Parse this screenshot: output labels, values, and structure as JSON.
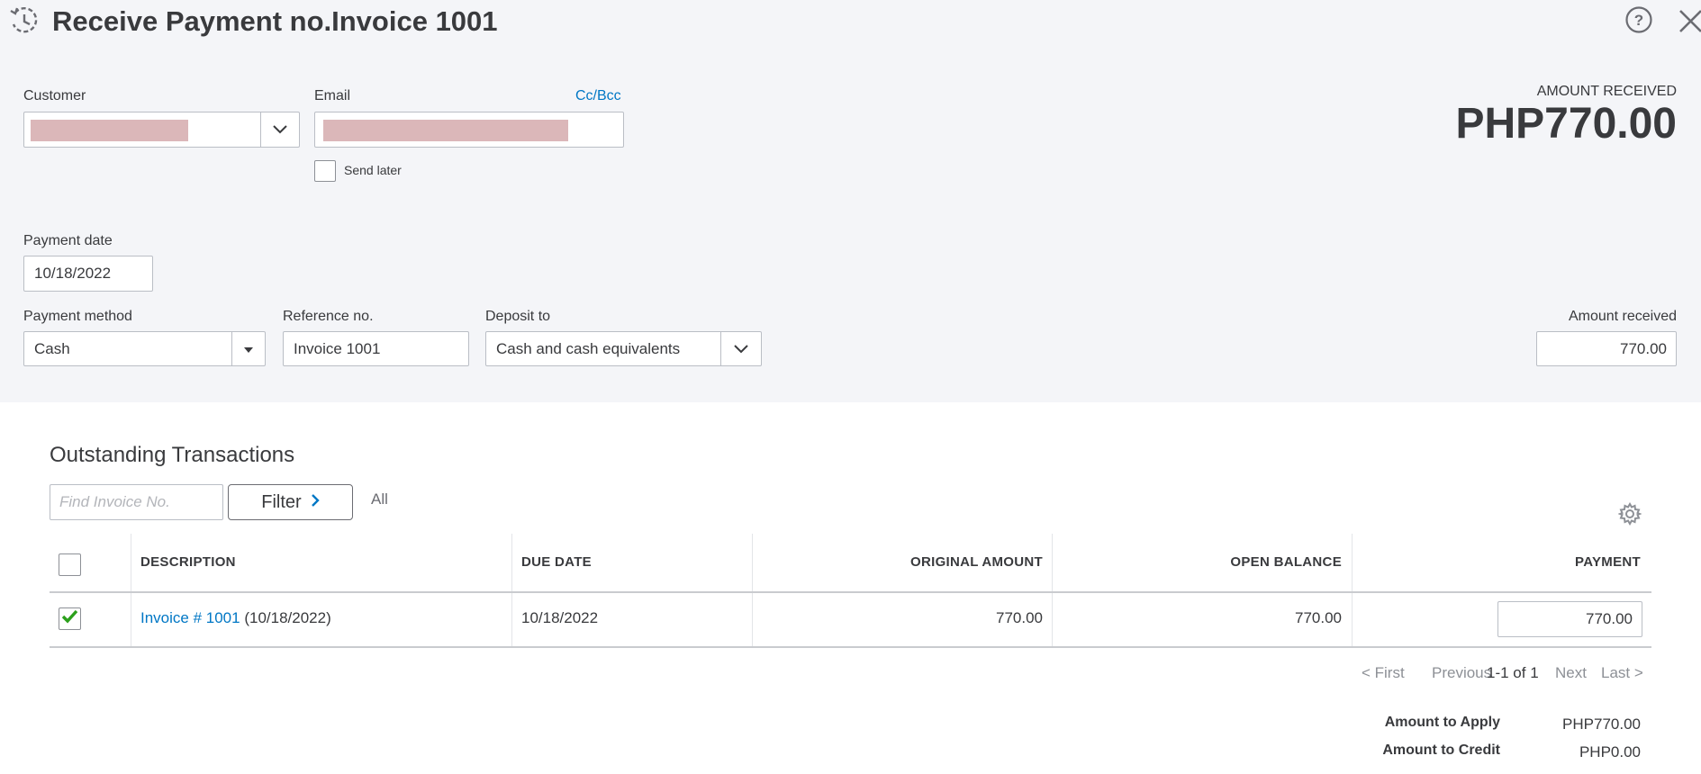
{
  "header": {
    "title": "Receive Payment no.Invoice 1001"
  },
  "customer": {
    "label": "Customer"
  },
  "email": {
    "label": "Email",
    "cc_bcc": "Cc/Bcc",
    "send_later": "Send later"
  },
  "amount_summary": {
    "label": "AMOUNT RECEIVED",
    "value": "PHP770.00"
  },
  "payment_date": {
    "label": "Payment date",
    "value": "10/18/2022"
  },
  "payment_method": {
    "label": "Payment method",
    "value": "Cash"
  },
  "reference": {
    "label": "Reference no.",
    "value": "Invoice 1001"
  },
  "deposit_to": {
    "label": "Deposit to",
    "value": "Cash and cash equivalents"
  },
  "amount_received": {
    "label": "Amount received",
    "value": "770.00"
  },
  "outstanding": {
    "title": "Outstanding Transactions",
    "find_placeholder": "Find Invoice No.",
    "filter_label": "Filter",
    "all_label": "All",
    "columns": {
      "description": "DESCRIPTION",
      "due_date": "DUE DATE",
      "original_amount": "ORIGINAL AMOUNT",
      "open_balance": "OPEN BALANCE",
      "payment": "PAYMENT"
    },
    "rows": [
      {
        "checked": true,
        "invoice_link": "Invoice # 1001",
        "invoice_date": "(10/18/2022)",
        "due_date": "10/18/2022",
        "original_amount": "770.00",
        "open_balance": "770.00",
        "payment": "770.00"
      }
    ],
    "pager": {
      "first": "< First",
      "previous": "Previous",
      "range": "1-1 of 1",
      "next": "Next",
      "last": "Last >"
    }
  },
  "totals": {
    "apply_label": "Amount to Apply",
    "apply_value": "PHP770.00",
    "credit_label": "Amount to Credit",
    "credit_value": "PHP0.00"
  },
  "icons": [
    "history-icon",
    "help-icon",
    "close-icon",
    "chevron-down-icon",
    "caret-down-icon",
    "chevron-right-icon",
    "gear-icon",
    "checkmark-icon"
  ],
  "colors": {
    "link": "#0077c5",
    "check": "#2ca01c",
    "panel": "#f4f5f8"
  }
}
